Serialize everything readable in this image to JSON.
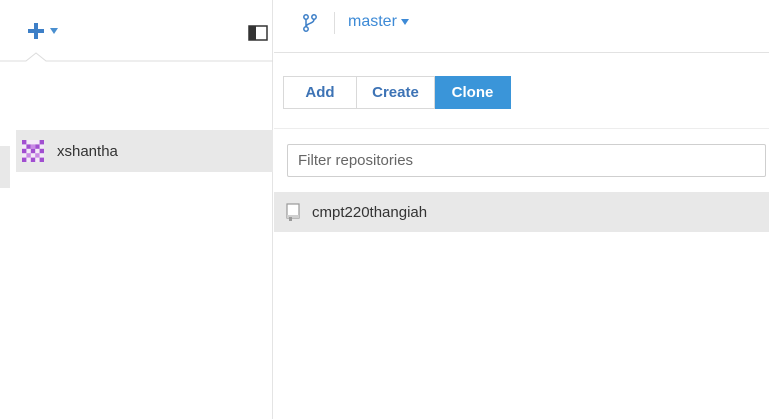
{
  "toolbar": {
    "add_icon": "plus-icon",
    "add_caret_icon": "caret-down-icon",
    "sidebar_toggle_icon": "sidebar-toggle-icon",
    "accent_color": "#3a95d9"
  },
  "branch": {
    "icon": "git-branch-icon",
    "name": "master",
    "caret_icon": "caret-down-icon"
  },
  "segments": {
    "add_label": "Add",
    "create_label": "Create",
    "clone_label": "Clone",
    "selected": "Clone"
  },
  "accounts": {
    "items": [
      {
        "name": "xshantha",
        "avatar_icon": "identicon-avatar"
      }
    ]
  },
  "filter": {
    "placeholder": "Filter repositories",
    "value": ""
  },
  "repositories": {
    "items": [
      {
        "name": "cmpt220thangiah",
        "icon": "repository-icon"
      }
    ]
  }
}
